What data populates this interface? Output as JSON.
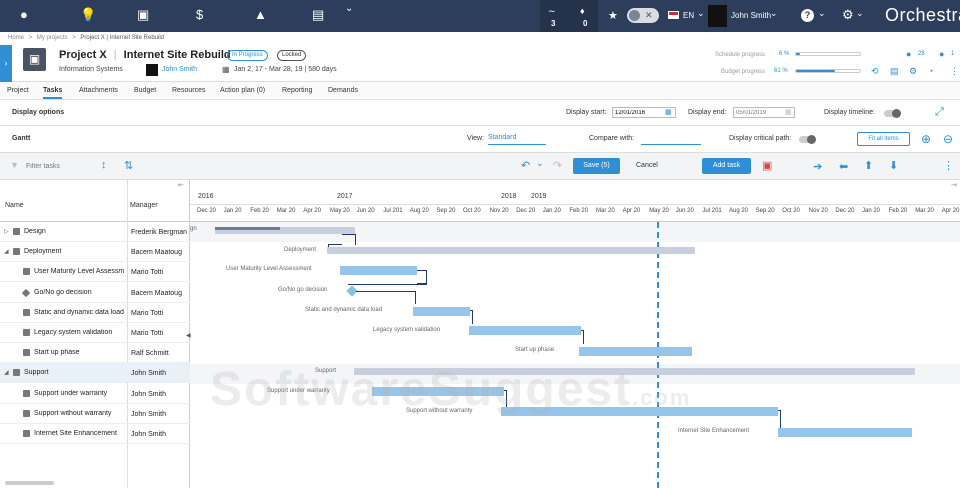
{
  "topbar": {
    "feed_count": "3",
    "notif_count": "0",
    "lang": "EN",
    "user_name": "John Smith",
    "brand": "Orchestra"
  },
  "breadcrumb": {
    "home": "Home",
    "sep1": ">",
    "projects": "My projects",
    "sep2": ">",
    "current": "Project X | Internet Site Rebuild"
  },
  "project": {
    "title": "Project X",
    "subtitle": "Internet Site Rebuild",
    "status": "In Progress",
    "lock": "Locked",
    "department": "Information Systems",
    "manager": "John Smith",
    "dates": "Jan 2, 17 - Mar 28, 19 | 580 days",
    "schedule_label": "Schedule progress",
    "schedule_pct": "6 %",
    "schedule_value": 6,
    "budget_label": "Budget progress",
    "budget_pct": "61 %",
    "budget_value": 61,
    "issues_count": "28",
    "comments_count": "1"
  },
  "tabs": [
    "Project",
    "Tasks",
    "Attachments",
    "Budget",
    "Resources",
    "Action plan (0)",
    "Reporting",
    "Demands"
  ],
  "display_options": {
    "title": "Display options",
    "start_label": "Display start:",
    "start_value": "12/01/2016",
    "end_label": "Display end:",
    "end_placeholder": "05/01/2019",
    "timeline_label": "Display timeline:"
  },
  "gantt": {
    "title": "Gantt",
    "view_label": "View:",
    "view_value": "Standard",
    "compare_label": "Compare with:",
    "critical_label": "Display critical path:",
    "fit_label": "Fit all items"
  },
  "toolbar": {
    "filter_placeholder": "Filter tasks",
    "save_label": "Save (5)",
    "cancel_label": "Cancel",
    "add_label": "Add task"
  },
  "grid": {
    "col_name": "Name",
    "col_manager": "Manager",
    "rows": [
      {
        "name": "Design",
        "manager": "Frederik Bergman"
      },
      {
        "name": "Deployment",
        "manager": "Bacem Maatoug"
      },
      {
        "name": "User Maturity Level Assessm...",
        "manager": "Mario Totti"
      },
      {
        "name": "Go/No go decision",
        "manager": "Bacem Maatoug"
      },
      {
        "name": "Static and dynamic data load",
        "manager": "Mario Totti"
      },
      {
        "name": "Legacy system validation",
        "manager": "Mario Totti"
      },
      {
        "name": "Start up phase",
        "manager": "Ralf Schmitt"
      },
      {
        "name": "Support",
        "manager": "John Smith"
      },
      {
        "name": "Support under warranty",
        "manager": "John Smith"
      },
      {
        "name": "Support without warranty",
        "manager": "John Smith"
      },
      {
        "name": "Internet Site Enhancement",
        "manager": "John Smith"
      }
    ]
  },
  "timeline": {
    "years": [
      "2016",
      "2017",
      "2018",
      "2019"
    ],
    "months": [
      "Dec 20",
      "Jan 20",
      "Feb 20",
      "Mar 20",
      "Apr 20",
      "May 20",
      "Jun 20",
      "Jul 201",
      "Aug 20",
      "Sep 20",
      "Oct 20",
      "Nov 20",
      "Dec 20",
      "Jan 20",
      "Feb 20",
      "Mar 20",
      "Apr 20",
      "May 20",
      "Jun 20",
      "Jul 201",
      "Aug 20",
      "Sep 20",
      "Oct 20",
      "Nov 20",
      "Dec 20",
      "Jan 20",
      "Feb 20",
      "Mar 20",
      "Apr 20"
    ]
  },
  "bars": {
    "design_label": "gn",
    "deployment_label": "Deployment",
    "b1": "User Maturity Level Assessment",
    "b2": "Go/No go decision",
    "b3": "Static and dynamic data load",
    "b4": "Legacy system validation",
    "b5": "Start up phase",
    "support_label": "Support",
    "b6": "Support under warranty",
    "b7": "Support without warranty",
    "b8": "Internet Site Enhancement"
  },
  "watermark": {
    "main": "SoftwareSuggest",
    "suffix": ".com"
  }
}
